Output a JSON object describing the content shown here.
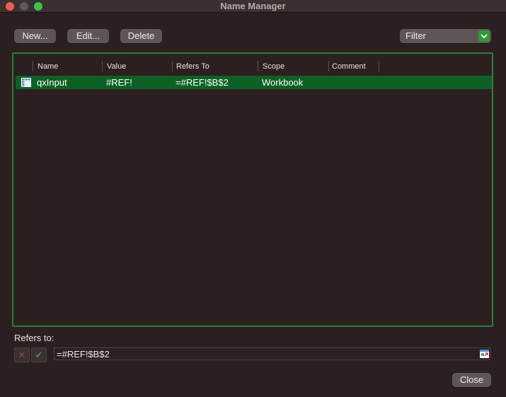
{
  "window": {
    "title": "Name Manager"
  },
  "toolbar": {
    "new_label": "New...",
    "edit_label": "Edit...",
    "delete_label": "Delete"
  },
  "filter": {
    "label": "Filter"
  },
  "columns": [
    "Name",
    "Value",
    "Refers To",
    "Scope",
    "Comment"
  ],
  "rows": [
    {
      "icon": "named-range-grid-icon",
      "name": "qxInput",
      "value": "#REF!",
      "refers_to": "=#REF!$B$2",
      "scope": "Workbook",
      "comment": ""
    }
  ],
  "refers_section": {
    "label": "Refers to:",
    "value": "=#REF!$B$2"
  },
  "footer": {
    "close_label": "Close"
  },
  "colors": {
    "accent": "#2f7d3a",
    "selection": "#0d6125",
    "background": "#2b201f"
  }
}
